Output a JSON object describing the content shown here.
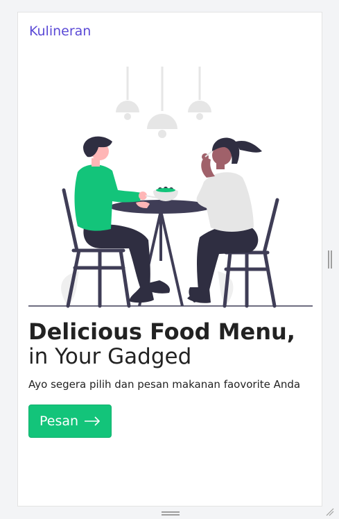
{
  "navbar": {
    "brand": "Kulineran"
  },
  "hero": {
    "headline": "Delicious Food Menu,",
    "subheadline": "in Your Gadged",
    "description": "Ayo segera pilih dan pesan makanan faovorite Anda",
    "cta_label": "Pesan",
    "cta_icon": "arrow-right-icon",
    "illustration": "two-people-eating-at-table"
  },
  "colors": {
    "brand": "#5b4ad6",
    "cta": "#13c47a",
    "text": "#222222",
    "illustration_dark": "#3f3d56",
    "illustration_accent": "#13c47a"
  }
}
